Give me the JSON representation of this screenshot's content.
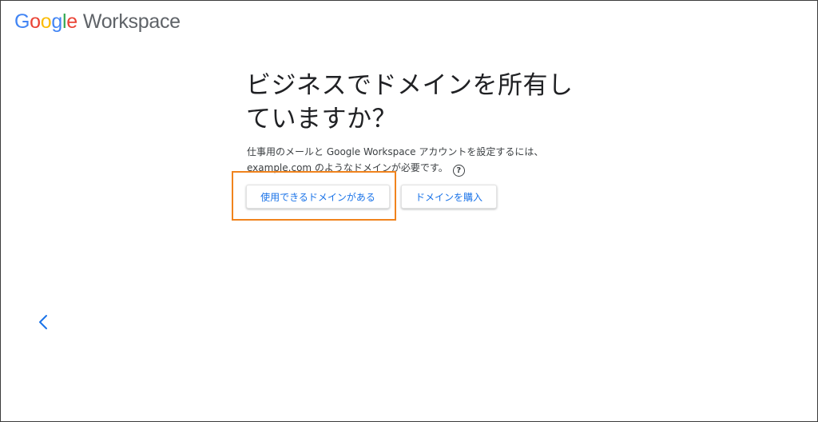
{
  "logo": {
    "letters": [
      "G",
      "o",
      "o",
      "g",
      "l",
      "e"
    ],
    "product": "Workspace",
    "colors": {
      "blue": "#4285f4",
      "red": "#ea4335",
      "yellow": "#fbbc05",
      "green": "#34a853",
      "gray": "#5f6368"
    }
  },
  "main": {
    "title_line1": "ビジネスでドメインを所有し",
    "title_line2": "ていますか？",
    "description_line1": "仕事用のメールと Google Workspace アカウントを設定するには、",
    "description_line2": "example.com のようなドメインが必要です。",
    "help_icon": "help-circle-icon",
    "help_glyph": "?"
  },
  "buttons": {
    "have_domain": "使用できるドメインがある",
    "buy_domain": "ドメインを購入"
  },
  "navigation": {
    "back_icon": "chevron-left-icon"
  },
  "accent": {
    "link_blue": "#1a73e8",
    "highlight_orange": "#f0831d"
  }
}
